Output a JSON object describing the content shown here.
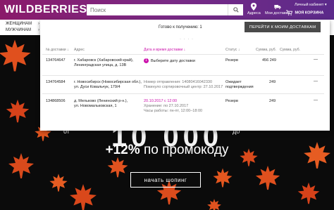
{
  "header": {
    "logo": "WILDBERRIES",
    "search_placeholder": "Поиск",
    "address_label": "Адреса",
    "deliveries_label": "Мои доставки",
    "cabinet_label": "Личный кабинет",
    "cart_label": "МОЯ КОРЗИНА",
    "colors": {
      "brand_start": "#8a1a6a",
      "brand_end": "#5b2a8a",
      "accent": "#cb11ab"
    }
  },
  "nav": {
    "items": [
      {
        "label": "ЖЕНЩИНАМ",
        "arrow": "›"
      },
      {
        "label": "МУЖЧИНАМ",
        "arrow": "›"
      }
    ],
    "right_fragments": [
      "Е",
      "К"
    ]
  },
  "popup": {
    "ready_text": "Готово к получению: 1",
    "go_button": "ПЕРЕЙТИ К МОИМ ДОСТАВКАМ",
    "dots": "· · · ·",
    "columns": {
      "num": "№ доставки ↓",
      "addr": "Адрес",
      "date": "Дата и время доставки ↓",
      "status": "Статус ↓",
      "sum": "Сумма, руб.",
      "paid": "Сумма, руб."
    },
    "rows": [
      {
        "num": "134764647",
        "addr1": "г. Хабаровск (Хабаровский край),",
        "addr2": "Ленинградская улица, д. 13В",
        "badge": "1",
        "date1": "Выберите дату доставки",
        "date2": "",
        "date3": "",
        "status1": "Резерв",
        "status2": "",
        "sum": "456 249",
        "dash": "—"
      },
      {
        "num": "134764584",
        "addr1": "г. Новосибирск (Новосибирская обл.),",
        "addr2": "ул. Дуси Ковальчук, 179/4",
        "badge": "",
        "date1": "Номер отправления: 14080416042330",
        "date2": "Покинуло сортировочный центр: 27.10.2017",
        "date3": "",
        "status1": "Ожидает",
        "status2": "подтверждения",
        "sum": "249",
        "dash": "—"
      },
      {
        "num": "134868506",
        "addr1": "д. Мельково (Ленинский р-н.),",
        "addr2": "ул. Новомальковская, 1",
        "badge": "",
        "date1": "20.10.2017 с 12:00",
        "date2": "Хранение: по 27.10.2017",
        "date3": "Часы работы: пн-пт, 12:00–18:00",
        "status1": "Резерв",
        "status2": "",
        "sum": "249",
        "dash": "—"
      }
    ]
  },
  "hero": {
    "big_text": "10 000",
    "promo_percent": "+12%",
    "promo_rest": " по промокоду",
    "shop_button": "начать шопинг",
    "side_left": "от",
    "side_right": "до"
  }
}
